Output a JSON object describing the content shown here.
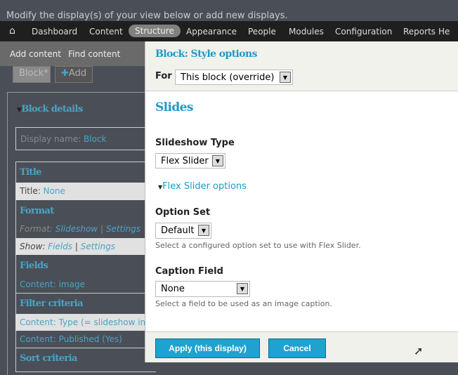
{
  "intro": "Modify the display(s) of your view below or add new displays.",
  "toolbar": {
    "items": [
      "Dashboard",
      "Content",
      "Structure",
      "Appearance",
      "People",
      "Modules",
      "Configuration",
      "Reports",
      "He"
    ],
    "active": "Structure"
  },
  "shortcuts": [
    "Add content",
    "Find content"
  ],
  "tabs": {
    "block": "Block*",
    "add": "Add"
  },
  "left": {
    "block_details": "Block details",
    "display_name_label": "Display name:",
    "display_name": "Block",
    "title_heading": "Title",
    "title_label": "Title:",
    "title_value": "None",
    "format_heading": "Format",
    "format_label": "Format:",
    "format_value": "Slideshow",
    "settings": "Settings",
    "sep": "|",
    "show_label": "Show:",
    "show_value": "Fields",
    "fields_heading": "Fields",
    "field1": "Content: image",
    "filter_heading": "Filter criteria",
    "filter1": "Content: Type (= slideshow image)",
    "filter2": "Content: Published (Yes)",
    "sort_heading": "Sort criteria"
  },
  "dialog": {
    "title": "Block: Style options",
    "for_label": "For",
    "for_value": "This block (override)",
    "section": "Slides",
    "slideshow_type_label": "Slideshow Type",
    "slideshow_type_value": "Flex Slider",
    "flex_options": "Flex Slider options",
    "option_set_label": "Option Set",
    "option_set_value": "Default",
    "option_set_desc": "Select a configured option set to use with Flex Slider.",
    "caption_label": "Caption Field",
    "caption_value": "None",
    "caption_desc": "Select a field to be used as an image caption.",
    "apply": "Apply (this display)",
    "cancel": "Cancel"
  },
  "colors": {
    "accent": "#1fa2cf",
    "link": "#4aa3c4",
    "background": "#4a4f57"
  }
}
